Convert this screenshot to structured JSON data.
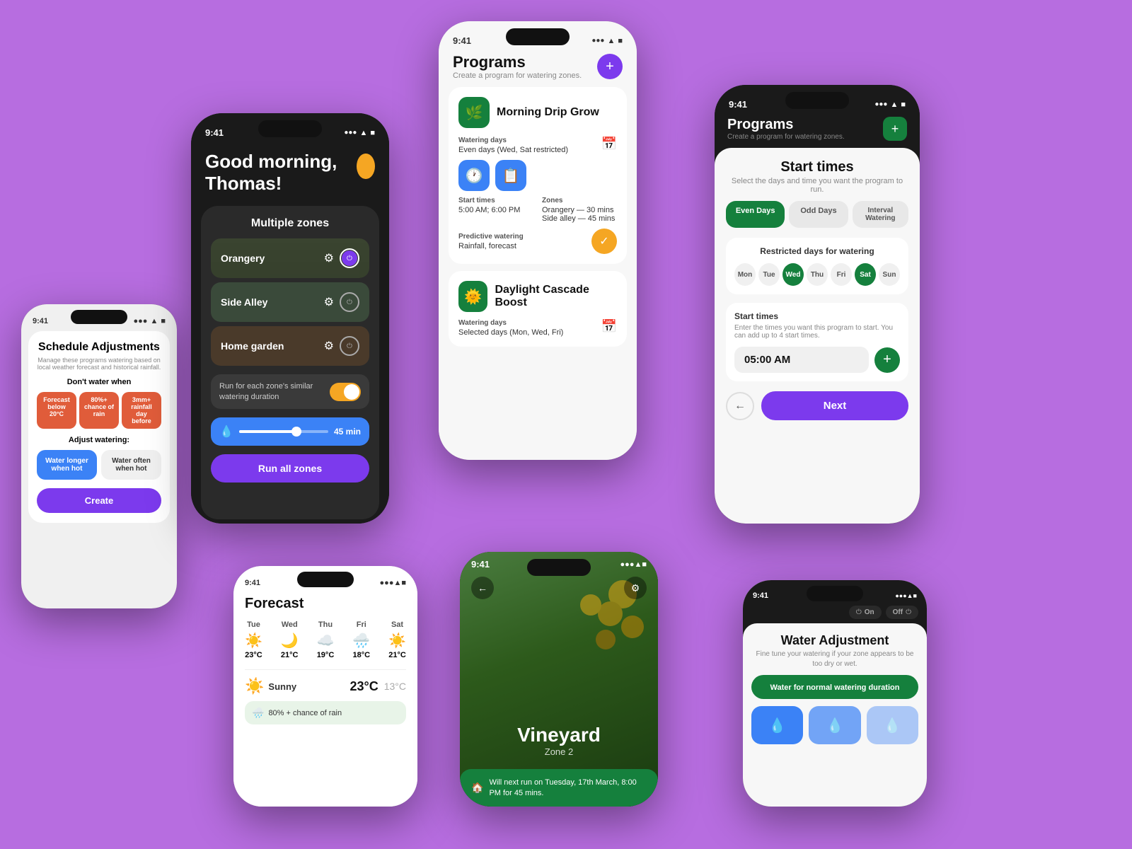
{
  "background": "#b76de0",
  "phones": {
    "phone1": {
      "time": "9:41",
      "title": "Schedule Adjustments",
      "subtitle": "Manage these programs watering based on local weather forecast and historical rainfall.",
      "dont_water_label": "Don't water when",
      "conditions": [
        {
          "label": "Forecast below 20°C",
          "color": "#e05c3a"
        },
        {
          "label": "80%+ chance of rain",
          "color": "#e05c3a"
        },
        {
          "label": "3mm+ rainfall day before",
          "color": "#e05c3a"
        }
      ],
      "adjust_label": "Adjust watering:",
      "btn_water_longer": "Water longer when hot",
      "btn_water_often": "Water often when hot",
      "create_btn": "Create"
    },
    "phone2": {
      "time": "9:41",
      "greeting": "Good morning, Thomas!",
      "section_title": "Multiple zones",
      "zones": [
        {
          "name": "Orangery"
        },
        {
          "name": "Side Alley"
        },
        {
          "name": "Home garden"
        }
      ],
      "toggle_label": "Run for each zone's similar watering duration",
      "duration": "45 min",
      "run_btn": "Run all zones"
    },
    "phone3": {
      "time": "9:41",
      "title": "Programs",
      "subtitle": "Create a program for watering zones.",
      "programs": [
        {
          "icon": "🌿",
          "name": "Morning Drip Grow",
          "watering_days_label": "Watering days",
          "watering_days_value": "Even days (Wed, Sat restricted)",
          "start_times_label": "Start times",
          "start_times_value": "5:00 AM; 6:00 PM",
          "zones_label": "Zones",
          "zones_value": "Orangery — 30 mins\nSide alley — 45 mins",
          "predictive_label": "Predictive watering",
          "predictive_value": "Rainfall, forecast"
        },
        {
          "icon": "☀️",
          "name": "Daylight Cascade Boost",
          "watering_days_label": "Watering days",
          "watering_days_value": "Selected days (Mon, Wed, Fri)"
        }
      ]
    },
    "phone4": {
      "time": "9:41",
      "title": "Forecast",
      "days": [
        "Tue",
        "Wed",
        "Thu",
        "Fri",
        "Sat"
      ],
      "temps": [
        "23°C",
        "21°C",
        "19°C",
        "18°C",
        "21°C"
      ],
      "icons": [
        "sun",
        "moon-cloud",
        "cloud",
        "cloud-rain",
        "sun"
      ],
      "bottom_label": "Sunny",
      "bottom_temp": "23°C",
      "bottom_low": "13°C",
      "rain_chance": "80% + chance of rain"
    },
    "phone5": {
      "time": "9:41",
      "zone_name": "Vineyard",
      "zone_sub": "Zone 2",
      "next_run": "Will next run on Tuesday, 17th March, 8:00 PM for 45 mins."
    },
    "phone6": {
      "time": "9:41",
      "title": "Programs",
      "subtitle": "Create a program for watering zones.",
      "modal_title": "Start times",
      "modal_subtitle": "Select the days and time you want the program to run.",
      "tabs": [
        "Even Days",
        "Odd Days",
        "Interval Watering"
      ],
      "restricted_label": "Restricted days for watering",
      "days": [
        "Mon",
        "Tue",
        "Wed",
        "Thu",
        "Fri",
        "Sat",
        "Sun"
      ],
      "highlighted_days": [
        "Wed",
        "Sat"
      ],
      "start_times_label": "Start times",
      "start_times_desc": "Enter the times you want this program to start. You can add up to 4 start times.",
      "time_value": "05:00 AM",
      "next_btn": "Next"
    },
    "phone7": {
      "title": "Water Adjustment",
      "subtitle": "Fine tune your watering if your zone appears to be too dry or wet.",
      "normal_btn": "Water for normal watering duration",
      "controls": [
        "decrease",
        "normal",
        "increase"
      ],
      "status_tabs": [
        "On",
        "Off"
      ]
    }
  }
}
